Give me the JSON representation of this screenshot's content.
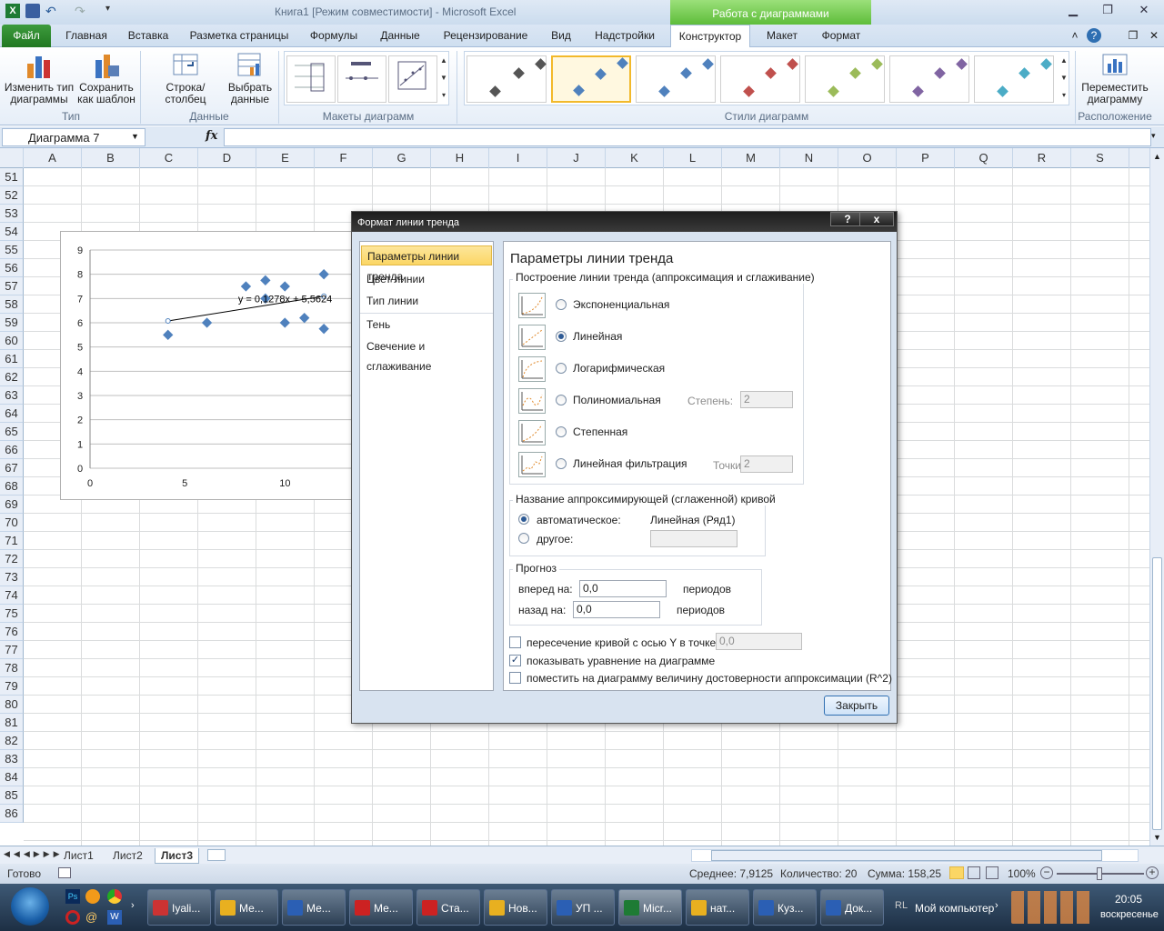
{
  "titlebar": {
    "title": "Книга1  [Режим совместимости]  -  Microsoft Excel",
    "context": "Работа с диаграммами"
  },
  "tabs": [
    "Файл",
    "Главная",
    "Вставка",
    "Разметка страницы",
    "Формулы",
    "Данные",
    "Рецензирование",
    "Вид",
    "Надстройки",
    "Конструктор",
    "Макет",
    "Формат"
  ],
  "ribbon": {
    "change_type": "Изменить тип диаграммы",
    "save_template": "Сохранить как шаблон",
    "grp_type": "Тип",
    "row_col": "Строка/столбец",
    "select_data": "Выбрать данные",
    "grp_data": "Данные",
    "grp_layouts": "Макеты диаграмм",
    "grp_styles": "Стили диаграмм",
    "move_chart": "Переместить диаграмму",
    "grp_location": "Расположение"
  },
  "namebox": "Диаграмма 7",
  "fx": "fx",
  "columns": [
    "A",
    "B",
    "C",
    "D",
    "E",
    "F",
    "G",
    "H",
    "I",
    "J",
    "K",
    "L",
    "M",
    "N",
    "O",
    "P",
    "Q",
    "R",
    "S"
  ],
  "rows": [
    "51",
    "52",
    "53",
    "54",
    "55",
    "56",
    "57",
    "58",
    "59",
    "60",
    "61",
    "62",
    "63",
    "64",
    "65",
    "66",
    "67",
    "68",
    "69",
    "70",
    "71",
    "72",
    "73",
    "74",
    "75",
    "76",
    "77",
    "78",
    "79",
    "80",
    "81",
    "82",
    "83",
    "84",
    "85",
    "86"
  ],
  "chart": {
    "equation": "y = 0,1278x + 5,5624",
    "yticks": [
      "9",
      "8",
      "7",
      "6",
      "5",
      "4",
      "3",
      "2",
      "1",
      "0"
    ],
    "xticks": [
      "0",
      "5",
      "10",
      "1"
    ]
  },
  "chart_data": {
    "type": "scatter",
    "series": [
      {
        "x": [
          4,
          6,
          8,
          9,
          9,
          10,
          10,
          11,
          12,
          12
        ],
        "y": [
          5.5,
          6,
          7.5,
          7.75,
          7,
          7.5,
          6,
          6.2,
          8,
          5.75
        ]
      }
    ],
    "trendline": {
      "type": "linear",
      "slope": 0.1278,
      "intercept": 5.5624,
      "label": "y = 0,1278x + 5,5624"
    },
    "xlim": [
      0,
      14
    ],
    "ylim": [
      0,
      9
    ]
  },
  "dialog": {
    "title": "Формат линии тренда",
    "help": "?",
    "close_x": "x",
    "nav": [
      "Параметры линии тренда",
      "Цвет линии",
      "Тип линии",
      "Тень",
      "Свечение и сглаживание"
    ],
    "heading": "Параметры линии тренда",
    "group_build": "Построение линии тренда (аппроксимация и сглаживание)",
    "types": [
      "Экспоненциальная",
      "Линейная",
      "Логарифмическая",
      "Полиномиальная",
      "Степенная",
      "Линейная фильтрация"
    ],
    "degree_label": "Степень:",
    "degree_value": "2",
    "points_label": "Точки:",
    "points_value": "2",
    "group_name": "Название аппроксимирующей (сглаженной) кривой",
    "auto_label": "автоматическое:",
    "auto_value": "Линейная (Ряд1)",
    "other_label": "другое:",
    "group_forecast": "Прогноз",
    "forward_label": "вперед на:",
    "forward_value": "0,0",
    "forward_unit": "периодов",
    "back_label": "назад на:",
    "back_value": "0,0",
    "back_unit": "периодов",
    "intercept_label": "пересечение кривой с осью Y в точке:",
    "intercept_value": "0,0",
    "show_eq": "показывать уравнение на диаграмме",
    "show_r2": "поместить на диаграмму величину достоверности аппроксимации (R^2)",
    "close_button": "Закрыть"
  },
  "sheets": [
    "Лист1",
    "Лист2",
    "Лист3"
  ],
  "status": {
    "ready": "Готово",
    "avg": "Среднее: 7,9125",
    "count": "Количество: 20",
    "sum": "Сумма: 158,25",
    "zoom": "100%"
  },
  "taskbar": {
    "buttons": [
      "Iyali...",
      "Ме...",
      "Ме...",
      "Ме...",
      "Ста...",
      "Нов...",
      "УП ...",
      "Micr...",
      "нат...",
      "Куз...",
      "Док..."
    ],
    "computer": "Мой компьютер",
    "time": "20:05",
    "day": "воскресенье"
  },
  "colors": {
    "accent": "#3d9b3d",
    "marker": "#4f81bd",
    "selection": "#fbd665"
  }
}
